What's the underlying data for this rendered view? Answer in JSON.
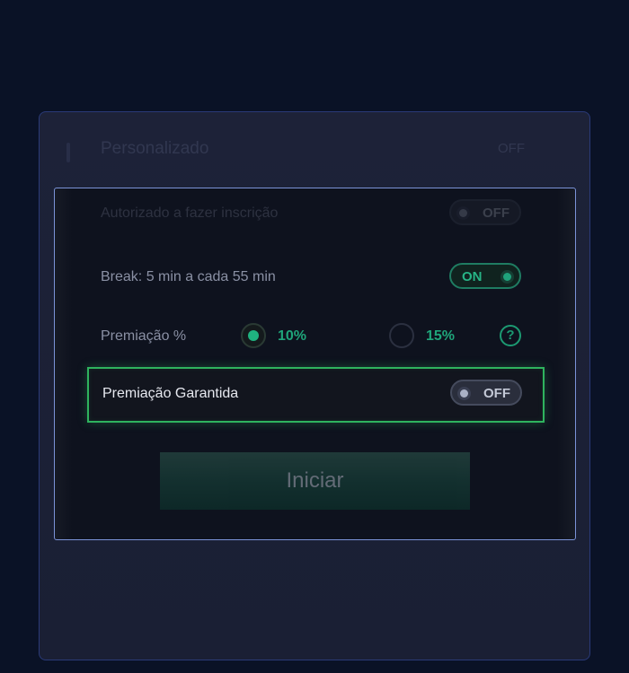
{
  "background_panel": {
    "title": "Personalizado",
    "right_label": "OFF"
  },
  "settings": {
    "registration": {
      "label": "Autorizado a fazer inscrição",
      "toggle": "OFF"
    },
    "break": {
      "label": "Break: 5 min a cada 55 min",
      "toggle": "ON"
    },
    "prize_percent": {
      "label": "Premiação %",
      "options": [
        {
          "label": "10%",
          "selected": true
        },
        {
          "label": "15%",
          "selected": false
        }
      ],
      "help_icon": "?"
    },
    "guaranteed_prize": {
      "label": "Premiação Garantida",
      "toggle": "OFF"
    }
  },
  "start_button": {
    "label": "Iniciar"
  },
  "colors": {
    "background": "#0a1226",
    "accent_green": "#1fa57a",
    "highlight_border": "#2fb35e",
    "panel_border": "#7b93d8"
  }
}
